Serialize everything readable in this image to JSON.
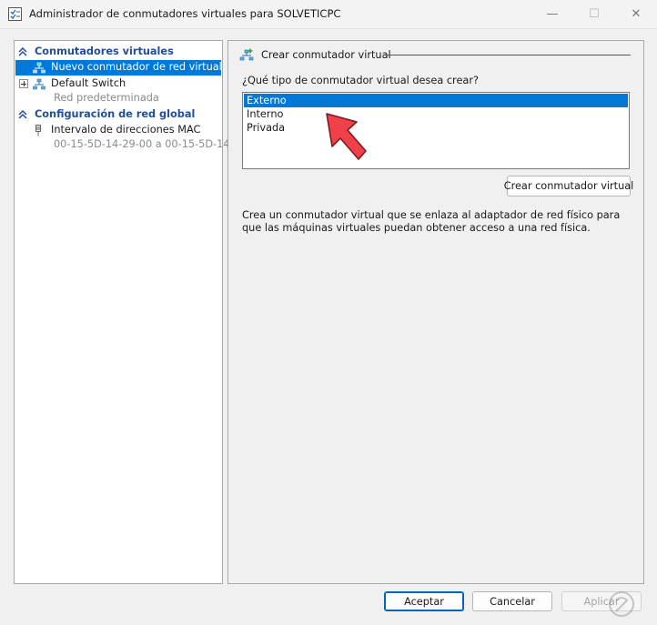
{
  "window": {
    "title": "Administrador de conmutadores virtuales para SOLVETICPC",
    "controls": {
      "minimize": "—",
      "maximize": "☐",
      "close": "✕"
    }
  },
  "left_pane": {
    "section1": {
      "label": "Conmutadores virtuales"
    },
    "new_switch": {
      "label": "Nuevo conmutador de red virtual"
    },
    "default_switch": {
      "label": "Default Switch",
      "sub": "Red predeterminada"
    },
    "section2": {
      "label": "Configuración de red global"
    },
    "mac_range": {
      "label": "Intervalo de direcciones MAC",
      "sub": "00-15-5D-14-29-00 a 00-15-5D-14..."
    }
  },
  "right_pane": {
    "header": "Crear conmutador virtual",
    "question": "¿Qué tipo de conmutador virtual desea crear?",
    "options": [
      "Externo",
      "Interno",
      "Privada"
    ],
    "selected_option": "Externo",
    "create_button": "Crear conmutador virtual",
    "description": "Crea un conmutador virtual que se enlaza al adaptador de red físico para que las máquinas virtuales puedan obtener acceso a una red física."
  },
  "footer": {
    "accept": "Aceptar",
    "cancel": "Cancelar",
    "apply": "Aplicar"
  },
  "colors": {
    "selection": "#0078d7",
    "section_heading": "#1f4e9e",
    "annotation_arrow": "#f0404a"
  }
}
